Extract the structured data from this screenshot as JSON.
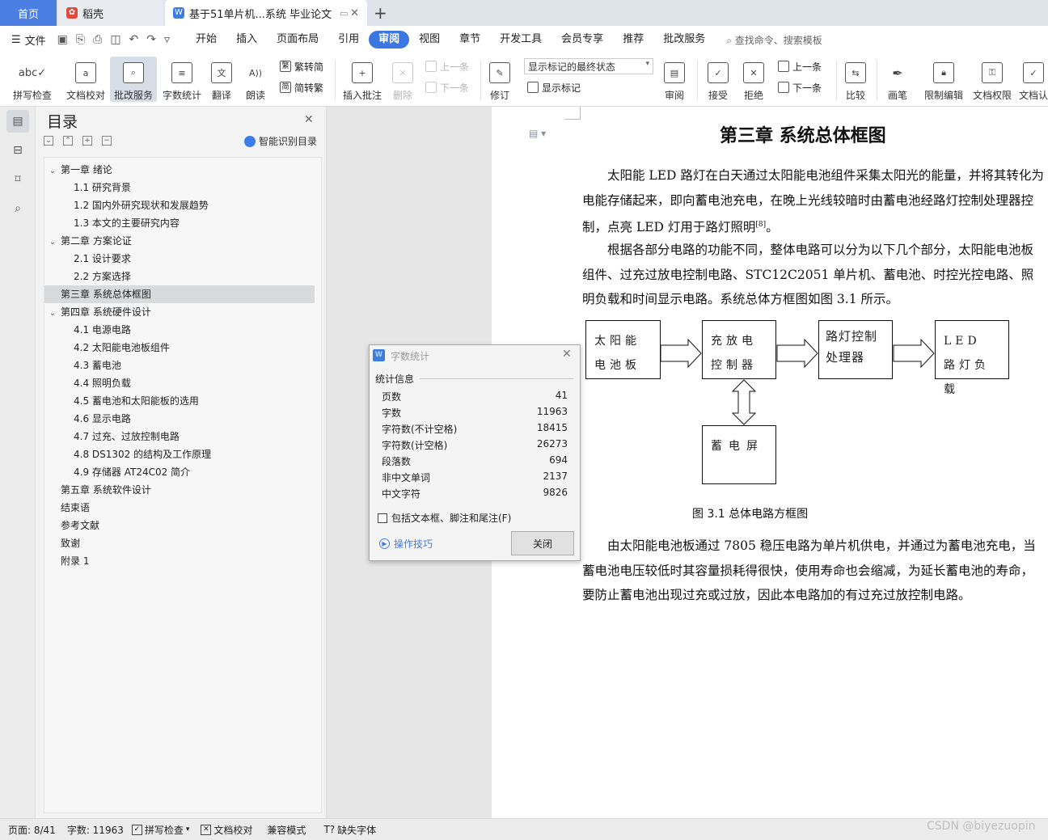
{
  "tabs": {
    "home": "首页",
    "daoke": "稻壳",
    "doc": "基于51单片机...系统 毕业论文"
  },
  "menubar": {
    "file": "文件",
    "items": [
      "开始",
      "插入",
      "页面布局",
      "引用",
      "审阅",
      "视图",
      "章节",
      "开发工具",
      "会员专享",
      "推荐",
      "批改服务"
    ],
    "active": "审阅",
    "search": "查找命令、搜索模板"
  },
  "ribbon": {
    "spell": "拼写检查",
    "proof": "文档校对",
    "correct": "批改服务",
    "wordcount": "字数统计",
    "translate": "翻译",
    "read": "朗读",
    "trad_to_simp": "繁转简",
    "simp_to_trad": "简转繁",
    "insert_comment": "插入批注",
    "delete": "删除",
    "prev_comment": "上一条",
    "next_comment": "下一条",
    "revise": "修订",
    "markup_state": "显示标记的最终状态",
    "show_markup": "显示标记",
    "review": "审阅",
    "accept": "接受",
    "reject": "拒绝",
    "prev_change": "上一条",
    "next_change": "下一条",
    "compare": "比较",
    "pen": "画笔",
    "restrict": "限制编辑",
    "permission": "文档权限",
    "certify": "文档认"
  },
  "toc": {
    "title": "目录",
    "smart": "智能识别目录",
    "items": [
      {
        "label": "第一章  绪论",
        "level": 1,
        "arrow": true
      },
      {
        "label": "1.1 研究背景",
        "level": 2
      },
      {
        "label": "1.2 国内外研究现状和发展趋势",
        "level": 2
      },
      {
        "label": "1.3 本文的主要研究内容",
        "level": 2
      },
      {
        "label": "第二章  方案论证",
        "level": 1,
        "arrow": true
      },
      {
        "label": "2.1  设计要求",
        "level": 2
      },
      {
        "label": "2.2  方案选择",
        "level": 2
      },
      {
        "label": "第三章  系统总体框图",
        "level": 1,
        "selected": true
      },
      {
        "label": "第四章  系统硬件设计",
        "level": 1,
        "arrow": true
      },
      {
        "label": "4.1  电源电路",
        "level": 2
      },
      {
        "label": "4.2  太阳能电池板组件",
        "level": 2
      },
      {
        "label": "4.3  蓄电池",
        "level": 2
      },
      {
        "label": "4.4  照明负载",
        "level": 2
      },
      {
        "label": "4.5  蓄电池和太阳能板的选用",
        "level": 2
      },
      {
        "label": "4.6  显示电路",
        "level": 2
      },
      {
        "label": "4.7  过充、过放控制电路",
        "level": 2
      },
      {
        "label": "4.8 DS1302 的结构及工作原理",
        "level": 2
      },
      {
        "label": "4.9  存储器 AT24C02 简介",
        "level": 2
      },
      {
        "label": "第五章  系统软件设计",
        "level": 1
      },
      {
        "label": "结束语",
        "level": 1
      },
      {
        "label": "参考文献",
        "level": 1
      },
      {
        "label": "致谢",
        "level": 1
      },
      {
        "label": "附录 1",
        "level": 1
      }
    ]
  },
  "document": {
    "chapter_title": "第三章  系统总体框图",
    "para1": "太阳能 LED 路灯在白天通过太阳能电池组件采集太阳光的能量，并将其转化为电能存储起来，即向蓄电池充电，在晚上光线较暗时由蓄电池经路灯控制处理器控制，点亮 LED 灯用于路灯照明",
    "para1_ref": "[8]",
    "para1_end": "。",
    "para2": "根据各部分电路的功能不同，整体电路可以分为以下几个部分，太阳能电池板组件、过充过放电控制电路、STC12C2051 单片机、蓄电池、时控光控电路、照明负载和时间显示电路。系统总体方框图如图 3.1 所示。",
    "diagram": {
      "box1": "太阳能电池板",
      "box2": "充放电控制器",
      "box3": "路灯控制处理器",
      "box4": "LED 路灯负载",
      "box5": "蓄电屏"
    },
    "caption": "图 3.1  总体电路方框图",
    "para3": "由太阳能电池板通过 7805 稳压电路为单片机供电，并通过为蓄电池充电，当蓄电池电压较低时其容量损耗得很快，使用寿命也会缩减，为延长蓄电池的寿命，要防止蓄电池出现过充或过放，因此本电路加的有过充过放控制电路。"
  },
  "dialog": {
    "title": "字数统计",
    "section": "统计信息",
    "stats": [
      {
        "label": "页数",
        "value": "41"
      },
      {
        "label": "字数",
        "value": "11963"
      },
      {
        "label": "字符数(不计空格)",
        "value": "18415"
      },
      {
        "label": "字符数(计空格)",
        "value": "26273"
      },
      {
        "label": "段落数",
        "value": "694"
      },
      {
        "label": "非中文单词",
        "value": "2137"
      },
      {
        "label": "中文字符",
        "value": "9826"
      }
    ],
    "checkbox": "包括文本框、脚注和尾注(F)",
    "tips": "操作技巧",
    "close": "关闭"
  },
  "status": {
    "page": "页面: 8/41",
    "words": "字数: 11963",
    "spell": "拼写检查",
    "proof": "文档校对",
    "compat": "兼容模式",
    "missing_font": "缺失字体"
  },
  "watermark": "CSDN @biyezuopin",
  "colors": {
    "accent": "#3a77e0",
    "home_tab": "#4a7ee0",
    "daoke_icon": "#e04a3a"
  }
}
